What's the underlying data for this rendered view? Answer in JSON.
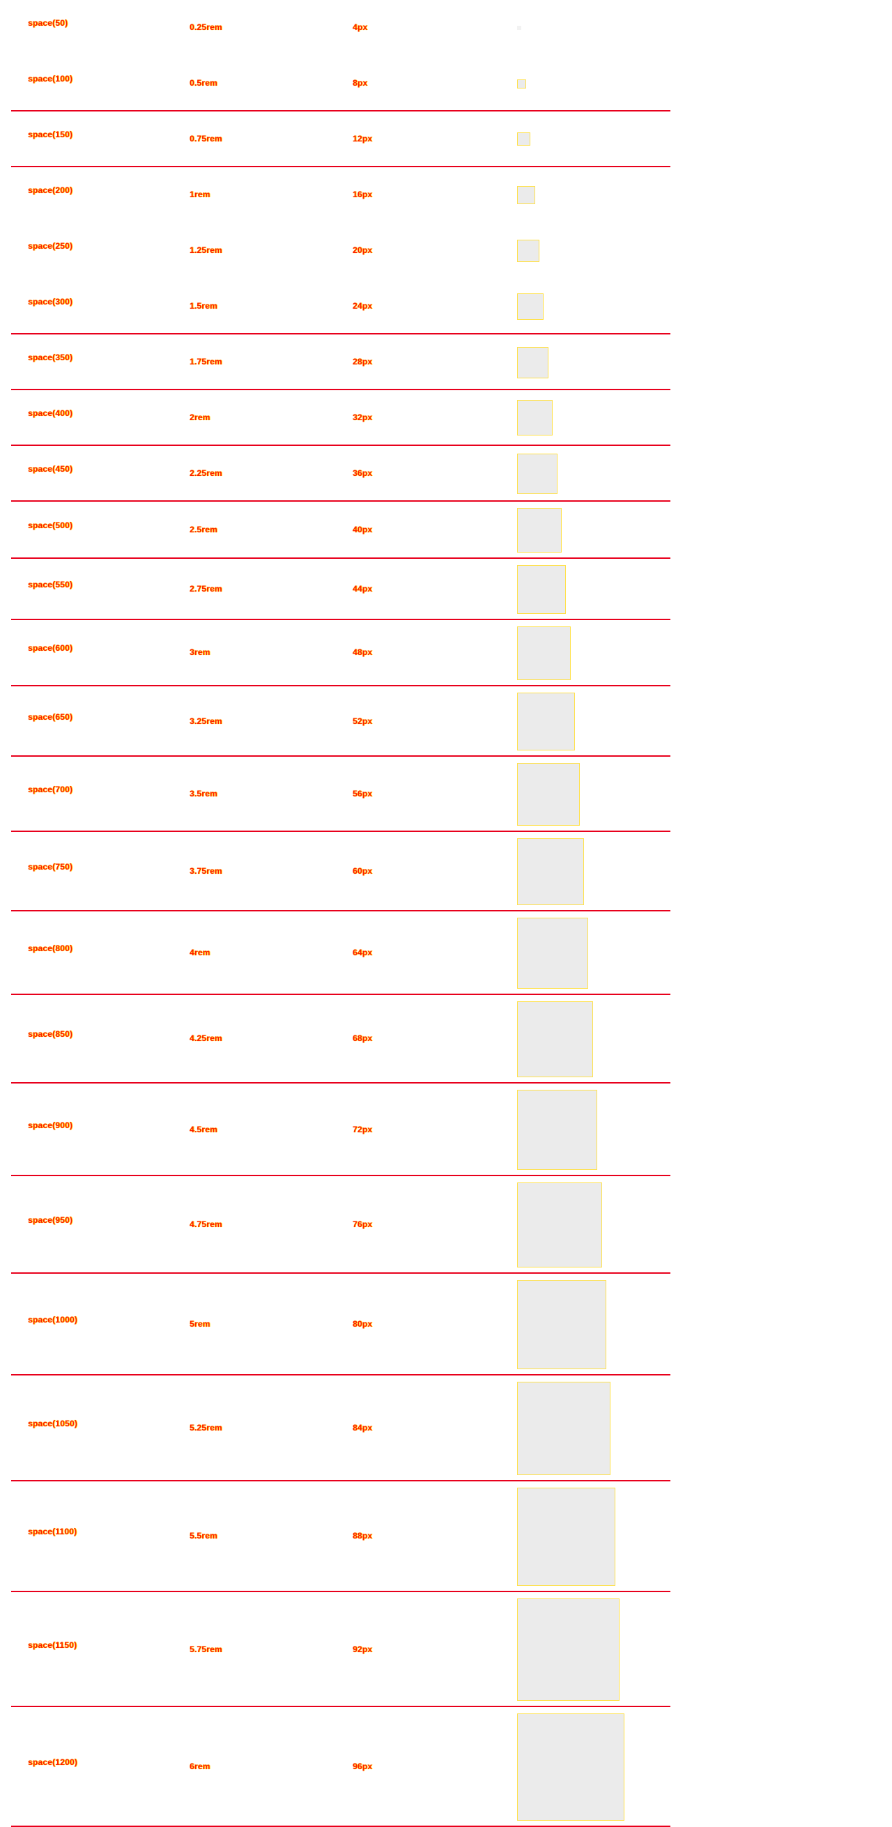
{
  "colors": {
    "text": "#ff1a00",
    "text_glow": "#ffd000",
    "divider": "#e8001c",
    "swatch_fill": "#ebebeb",
    "swatch_border": "#ffe14a"
  },
  "rows": [
    {
      "token": "space(50)",
      "rem": "0.25rem",
      "px": "4px",
      "size": 4
    },
    {
      "token": "space(100)",
      "rem": "0.5rem",
      "px": "8px",
      "size": 8
    },
    {
      "token": "space(150)",
      "rem": "0.75rem",
      "px": "12px",
      "size": 12
    },
    {
      "token": "space(200)",
      "rem": "1rem",
      "px": "16px",
      "size": 16
    },
    {
      "token": "space(250)",
      "rem": "1.25rem",
      "px": "20px",
      "size": 20
    },
    {
      "token": "space(300)",
      "rem": "1.5rem",
      "px": "24px",
      "size": 24
    },
    {
      "token": "space(350)",
      "rem": "1.75rem",
      "px": "28px",
      "size": 28
    },
    {
      "token": "space(400)",
      "rem": "2rem",
      "px": "32px",
      "size": 32
    },
    {
      "token": "space(450)",
      "rem": "2.25rem",
      "px": "36px",
      "size": 36
    },
    {
      "token": "space(500)",
      "rem": "2.5rem",
      "px": "40px",
      "size": 40
    },
    {
      "token": "space(550)",
      "rem": "2.75rem",
      "px": "44px",
      "size": 44
    },
    {
      "token": "space(600)",
      "rem": "3rem",
      "px": "48px",
      "size": 48
    },
    {
      "token": "space(650)",
      "rem": "3.25rem",
      "px": "52px",
      "size": 52
    },
    {
      "token": "space(700)",
      "rem": "3.5rem",
      "px": "56px",
      "size": 56
    },
    {
      "token": "space(750)",
      "rem": "3.75rem",
      "px": "60px",
      "size": 60
    },
    {
      "token": "space(800)",
      "rem": "4rem",
      "px": "64px",
      "size": 64
    },
    {
      "token": "space(850)",
      "rem": "4.25rem",
      "px": "68px",
      "size": 68
    },
    {
      "token": "space(900)",
      "rem": "4.5rem",
      "px": "72px",
      "size": 72
    },
    {
      "token": "space(950)",
      "rem": "4.75rem",
      "px": "76px",
      "size": 76
    },
    {
      "token": "space(1000)",
      "rem": "5rem",
      "px": "80px",
      "size": 80
    },
    {
      "token": "space(1050)",
      "rem": "5.25rem",
      "px": "84px",
      "size": 84
    },
    {
      "token": "space(1100)",
      "rem": "5.5rem",
      "px": "88px",
      "size": 88
    },
    {
      "token": "space(1150)",
      "rem": "5.75rem",
      "px": "92px",
      "size": 92
    },
    {
      "token": "space(1200)",
      "rem": "6rem",
      "px": "96px",
      "size": 96
    }
  ]
}
